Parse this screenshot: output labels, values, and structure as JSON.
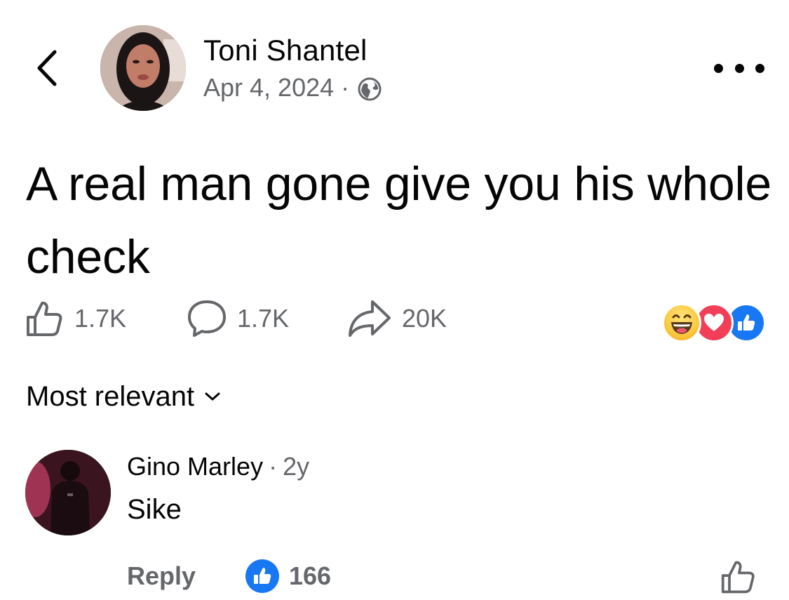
{
  "header": {
    "back_icon": "chevron-left-icon",
    "author_name": "Toni Shantel",
    "date": "Apr 4, 2024",
    "separator": "·",
    "privacy_icon": "globe-icon",
    "more_icon": "more-horizontal-icon"
  },
  "post": {
    "text": "A real man gone give you his whole check"
  },
  "actions": {
    "like_count": "1.7K",
    "comment_count": "1.7K",
    "share_count": "20K",
    "like_icon": "thumbs-up-outline-icon",
    "comment_icon": "speech-bubble-icon",
    "share_icon": "share-arrow-icon"
  },
  "reactions": [
    "haha-reaction-icon",
    "love-reaction-icon",
    "like-reaction-icon"
  ],
  "sort": {
    "label": "Most relevant",
    "icon": "chevron-down-icon"
  },
  "comment": {
    "author": "Gino Marley",
    "separator": "·",
    "time": "2y",
    "text": "Sike",
    "reply_label": "Reply",
    "like_count": "166"
  },
  "colors": {
    "text_primary": "#050505",
    "text_secondary": "#65676b",
    "facebook_blue": "#1877f2",
    "love_red": "#f33e58",
    "haha_yellow": "#fbc93e"
  }
}
